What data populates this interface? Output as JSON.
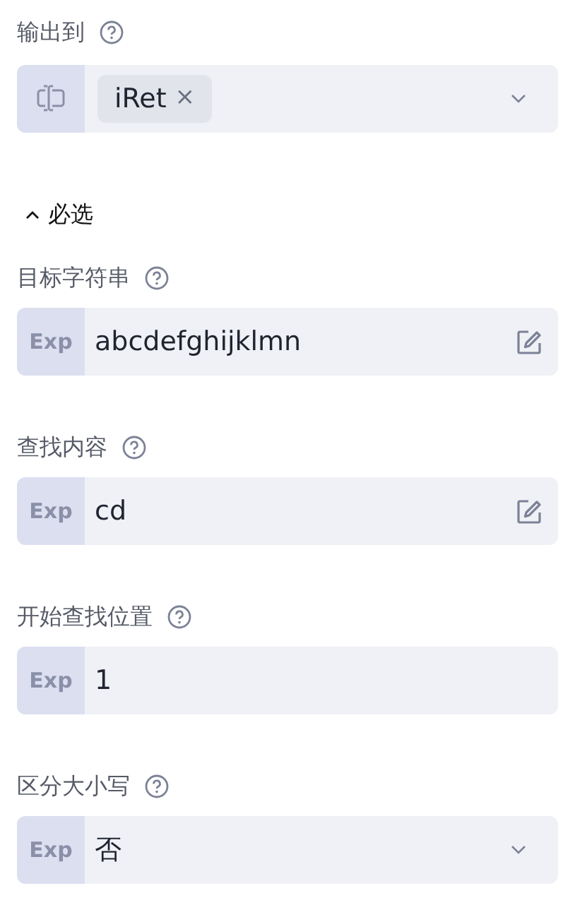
{
  "output": {
    "label": "输出到",
    "tags": [
      {
        "text": "iRet",
        "remove": "×"
      }
    ]
  },
  "section": {
    "title": "必选",
    "expanded": true
  },
  "fields": [
    {
      "label": "目标字符串",
      "prefix": "Exp",
      "value": "abcdefghijklmn",
      "kind": "editable"
    },
    {
      "label": "查找内容",
      "prefix": "Exp",
      "value": "cd",
      "kind": "editable"
    },
    {
      "label": "开始查找位置",
      "prefix": "Exp",
      "value": "1",
      "kind": "plain"
    },
    {
      "label": "区分大小写",
      "prefix": "Exp",
      "value": "否",
      "kind": "select"
    }
  ]
}
